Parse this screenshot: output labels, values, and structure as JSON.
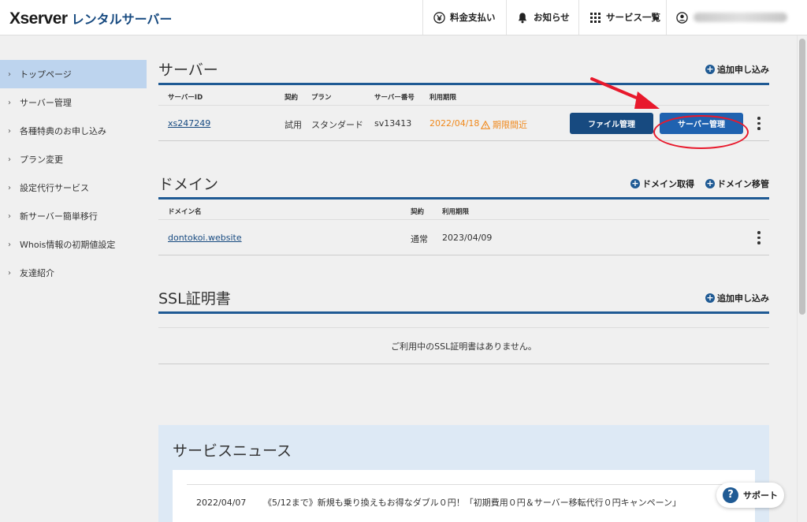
{
  "header": {
    "logo_main": "Xserver",
    "logo_sub": "レンタルサーバー",
    "nav": [
      {
        "label": "料金支払い",
        "icon": "yen-icon"
      },
      {
        "label": "お知らせ",
        "icon": "bell-icon"
      },
      {
        "label": "サービス一覧",
        "icon": "grid-icon"
      }
    ]
  },
  "sidebar": {
    "items": [
      {
        "label": "トップページ",
        "active": true
      },
      {
        "label": "サーバー管理"
      },
      {
        "label": "各種特典のお申し込み"
      },
      {
        "label": "プラン変更"
      },
      {
        "label": "設定代行サービス"
      },
      {
        "label": "新サーバー簡単移行"
      },
      {
        "label": "Whois情報の初期値設定"
      },
      {
        "label": "友達紹介"
      }
    ]
  },
  "server": {
    "title": "サーバー",
    "add_label": "追加申し込み",
    "headers": {
      "id": "サーバーID",
      "contract": "契約",
      "plan": "プラン",
      "number": "サーバー番号",
      "expiry": "利用期限"
    },
    "row": {
      "id": "xs247249",
      "contract": "試用",
      "plan": "スタンダード",
      "number": "sv13413",
      "expiry": "2022/04/18",
      "warning": "期限間近",
      "file_button": "ファイル管理",
      "server_button": "サーバー管理"
    }
  },
  "domain": {
    "title": "ドメイン",
    "get_label": "ドメイン取得",
    "transfer_label": "ドメイン移管",
    "headers": {
      "name": "ドメイン名",
      "contract": "契約",
      "expiry": "利用期限"
    },
    "row": {
      "name": "dontokoi.website",
      "contract": "通常",
      "expiry": "2023/04/09"
    }
  },
  "ssl": {
    "title": "SSL証明書",
    "add_label": "追加申し込み",
    "empty": "ご利用中のSSL証明書はありません。"
  },
  "news": {
    "title": "サービスニュース",
    "items": [
      {
        "date": "2022/04/07",
        "text": "《5/12まで》新規も乗り換えもお得なダブル０円！「初期費用０円＆サーバー移転代行０円キャンペーン」"
      }
    ]
  },
  "support": {
    "label": "サポート"
  },
  "colors": {
    "primary": "#1f5a94",
    "accent": "#e8192c",
    "warning": "#f0881a"
  }
}
